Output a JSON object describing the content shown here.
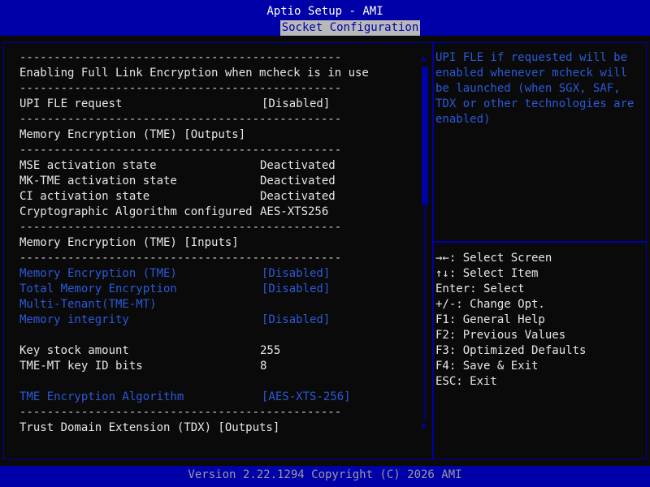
{
  "header": {
    "app_title": "Aptio Setup - AMI",
    "active_tab": "Socket Configuration"
  },
  "separator": "-----------------------------------------------",
  "settings": {
    "heading_fle": "Enabling Full Link Encryption when mcheck is in use",
    "upi_fle": {
      "label": "UPI FLE request",
      "value": "[Disabled]"
    },
    "heading_tme_outputs": "Memory Encryption (TME) [Outputs]",
    "mse_state": {
      "label": "MSE activation state",
      "value": "Deactivated"
    },
    "mk_tme_state": {
      "label": "MK-TME activation state",
      "value": "Deactivated"
    },
    "ci_state": {
      "label": "CI activation state",
      "value": "Deactivated"
    },
    "crypto_algo": {
      "label": "Cryptographic Algorithm configured",
      "value": "AES-XTS256"
    },
    "heading_tme_inputs": "Memory Encryption (TME) [Inputs]",
    "tme": {
      "label": "Memory Encryption (TME)",
      "value": "[Disabled]"
    },
    "total_mem_enc": {
      "label": "Total Memory Encryption",
      "value": "[Disabled]"
    },
    "multi_tenant": {
      "label": "Multi-Tenant(TME-MT)"
    },
    "mem_integrity": {
      "label": "Memory integrity",
      "value": "[Disabled]"
    },
    "key_stock": {
      "label": "Key stock amount",
      "value": "255"
    },
    "key_id_bits": {
      "label": "TME-MT key ID bits",
      "value": "8"
    },
    "tme_algo": {
      "label": "TME Encryption Algorithm",
      "value": "[AES-XTS-256]"
    },
    "heading_tdx": "Trust Domain Extension (TDX) [Outputs]"
  },
  "help": {
    "lines": [
      "UPI FLE if requested will be",
      "enabled whenever mcheck will",
      "be launched (when SGX, SAF,",
      "TDX or other technologies are",
      "enabled)"
    ]
  },
  "keys": {
    "select_screen": "→←: Select Screen",
    "select_item": "↑↓: Select Item",
    "enter_select": "Enter: Select",
    "change_opt": "+/-: Change Opt.",
    "general_help": "F1: General Help",
    "previous_values": "F2: Previous Values",
    "optimized_defaults": "F3: Optimized Defaults",
    "save_exit": "F4: Save & Exit",
    "esc_exit": "ESC: Exit"
  },
  "scroll": {
    "position": 0.0,
    "visible_fraction": 0.39
  },
  "footer": {
    "version": "Version 2.22.1294 Copyright (C) 2026 AMI"
  },
  "colors": {
    "accent_blue": "#0000a8",
    "link_blue": "#2a5ad8",
    "tab_bg": "#b9b9b9"
  }
}
